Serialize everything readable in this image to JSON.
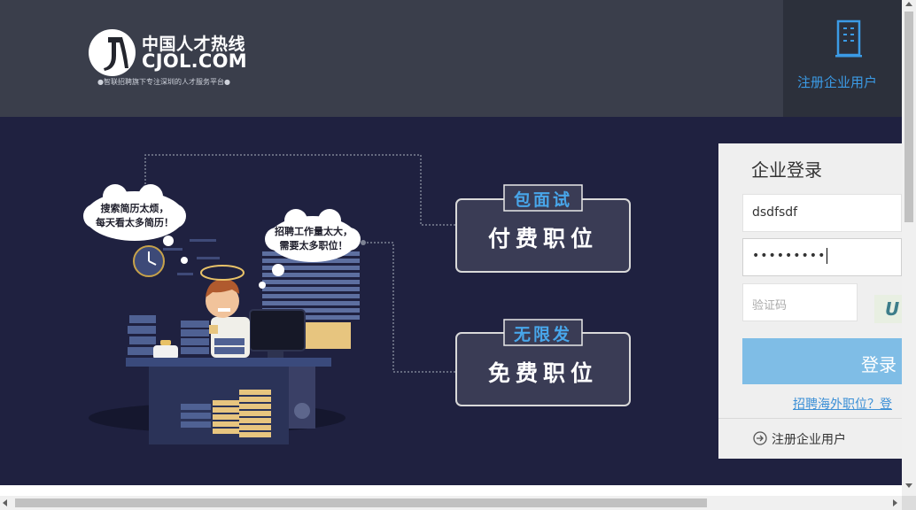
{
  "header": {
    "logo_cn": "中国人才热线",
    "logo_en": "CJOL.COM",
    "slogan": "●智联招聘旗下专注深圳的人才服务平台●",
    "register_label": "注册企业用户"
  },
  "banner": {
    "bubble_left": [
      "搜索简历太烦，",
      "每天看太多简历！"
    ],
    "bubble_right": [
      "招聘工作量太大，",
      "需要太多职位！"
    ],
    "paid": {
      "tag": "包面试",
      "label": "付费职位"
    },
    "free": {
      "tag": "无限发",
      "label": "免费职位"
    }
  },
  "login": {
    "title": "企业登录",
    "username_value": "dsdfsdf",
    "password_mask": "•••••••••",
    "captcha_placeholder": "验证码",
    "captcha_text": "U",
    "button_label": "登录",
    "overseas_link": "招聘海外职位？登",
    "register_link": "注册企业用户"
  },
  "colors": {
    "header_bg": "#3a3e4b",
    "banner_bg": "#1f2140",
    "accent": "#3b9be6",
    "login_button": "#7fbde6"
  }
}
